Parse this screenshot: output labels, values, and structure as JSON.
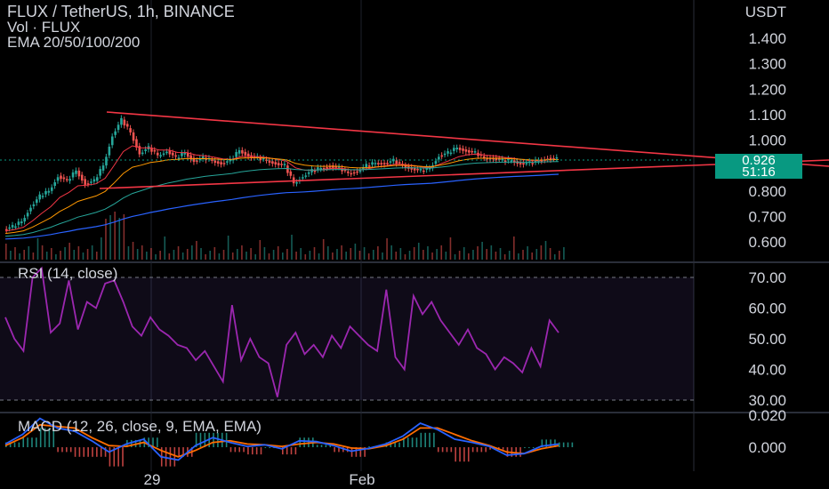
{
  "header": {
    "symbol": "FLUX / TetherUS, 1h, BINANCE",
    "volume": "Vol · FLUX",
    "ema": "EMA 20/50/100/200"
  },
  "axis": {
    "currency": "USDT",
    "price_ticks": [
      "1.400",
      "1.300",
      "1.200",
      "1.100",
      "1.000",
      "0.900",
      "0.800",
      "0.700",
      "0.600"
    ],
    "rsi_ticks": [
      "70.00",
      "60.00",
      "50.00",
      "40.00",
      "30.00"
    ],
    "macd_ticks": [
      "0.020",
      "0.000"
    ],
    "x_ticks": [
      "29",
      "Feb"
    ]
  },
  "last_price": {
    "value": "0.926",
    "countdown": "51:16"
  },
  "indicators": {
    "rsi_label": "RSI (14, close)",
    "macd_label": "MACD (12, 26, close, 9, EMA, EMA)"
  },
  "colors": {
    "background": "#000000",
    "up": "#26a69a",
    "down": "#ef5350",
    "trendline": "#f23645",
    "ema20": "#f23645",
    "ema50": "#ff9800",
    "ema100": "#26a69a",
    "ema200": "#2962ff",
    "rsi": "#9c27b0",
    "macd": "#2962ff",
    "signal": "#ff6d00"
  },
  "chart_data": [
    {
      "type": "candlestick",
      "title": "FLUX / TetherUS, 1h, BINANCE",
      "ylabel": "USDT",
      "ylim": [
        0.55,
        1.45
      ],
      "x_ticks": [
        "29",
        "Feb"
      ],
      "close_path": [
        0.65,
        0.66,
        0.68,
        0.74,
        0.78,
        0.8,
        0.86,
        0.84,
        0.88,
        0.83,
        0.84,
        0.9,
        1.02,
        1.08,
        1.03,
        0.95,
        0.97,
        0.94,
        0.96,
        0.93,
        0.95,
        0.92,
        0.93,
        0.92,
        0.91,
        0.92,
        0.96,
        0.94,
        0.93,
        0.92,
        0.91,
        0.9,
        0.83,
        0.86,
        0.88,
        0.89,
        0.9,
        0.89,
        0.87,
        0.88,
        0.9,
        0.91,
        0.91,
        0.92,
        0.9,
        0.89,
        0.88,
        0.89,
        0.94,
        0.95,
        0.97,
        0.96,
        0.95,
        0.93,
        0.93,
        0.92,
        0.92,
        0.91,
        0.91,
        0.92,
        0.93,
        0.926
      ],
      "last_price": 0.926,
      "trendlines": [
        {
          "points": [
            [
              0.13,
              1.115
            ],
            [
              0.835,
              0.915
            ]
          ]
        },
        {
          "points": [
            [
              0.12,
              0.81
            ],
            [
              0.835,
              0.925
            ]
          ]
        }
      ],
      "ema_series": [
        "EMA 20",
        "EMA 50",
        "EMA 100",
        "EMA 200"
      ]
    },
    {
      "type": "line",
      "title": "RSI (14, close)",
      "ylim": [
        25,
        75
      ],
      "bands": [
        30,
        70
      ],
      "values": [
        57,
        50,
        46,
        70,
        73,
        52,
        55,
        69,
        53,
        62,
        60,
        68,
        69,
        62,
        54,
        51,
        57,
        53,
        51,
        48,
        47,
        43,
        46,
        41,
        36,
        61,
        43,
        50,
        44,
        42,
        31,
        48,
        52,
        45,
        48,
        44,
        51,
        47,
        54,
        51,
        48,
        46,
        66,
        44,
        40,
        64,
        58,
        62,
        56,
        52,
        48,
        53,
        47,
        45,
        40,
        44,
        42,
        39,
        47,
        41,
        56,
        52
      ]
    },
    {
      "type": "line",
      "title": "MACD (12, 26, close, 9, EMA, EMA)",
      "ylim": [
        -0.012,
        0.02
      ],
      "series": [
        {
          "values": [
            0.002,
            0.008,
            0.018,
            0.012,
            0.01,
            0.004,
            -0.003,
            0.002,
            0.005,
            -0.006,
            -0.008,
            0.001,
            0.006,
            0.003,
            0.0005,
            0.0015,
            -0.001,
            0.004,
            0.0035,
            0.001,
            -0.0025,
            -0.0008,
            0.002,
            0.007,
            0.015,
            0.011,
            0.005,
            0.003,
            0.0005,
            -0.005,
            -0.004,
            0.0006,
            0.002
          ]
        },
        {
          "values": [
            0.001,
            0.006,
            0.014,
            0.013,
            0.012,
            0.006,
            0.001,
            0.0005,
            0.003,
            -0.002,
            -0.006,
            -0.002,
            0.003,
            0.004,
            0.002,
            0.0015,
            0.0005,
            0.002,
            0.003,
            0.002,
            -0.0005,
            -0.001,
            0.001,
            0.005,
            0.012,
            0.012,
            0.008,
            0.004,
            0.001,
            -0.003,
            -0.004,
            -0.001,
            0.001
          ]
        }
      ]
    }
  ]
}
